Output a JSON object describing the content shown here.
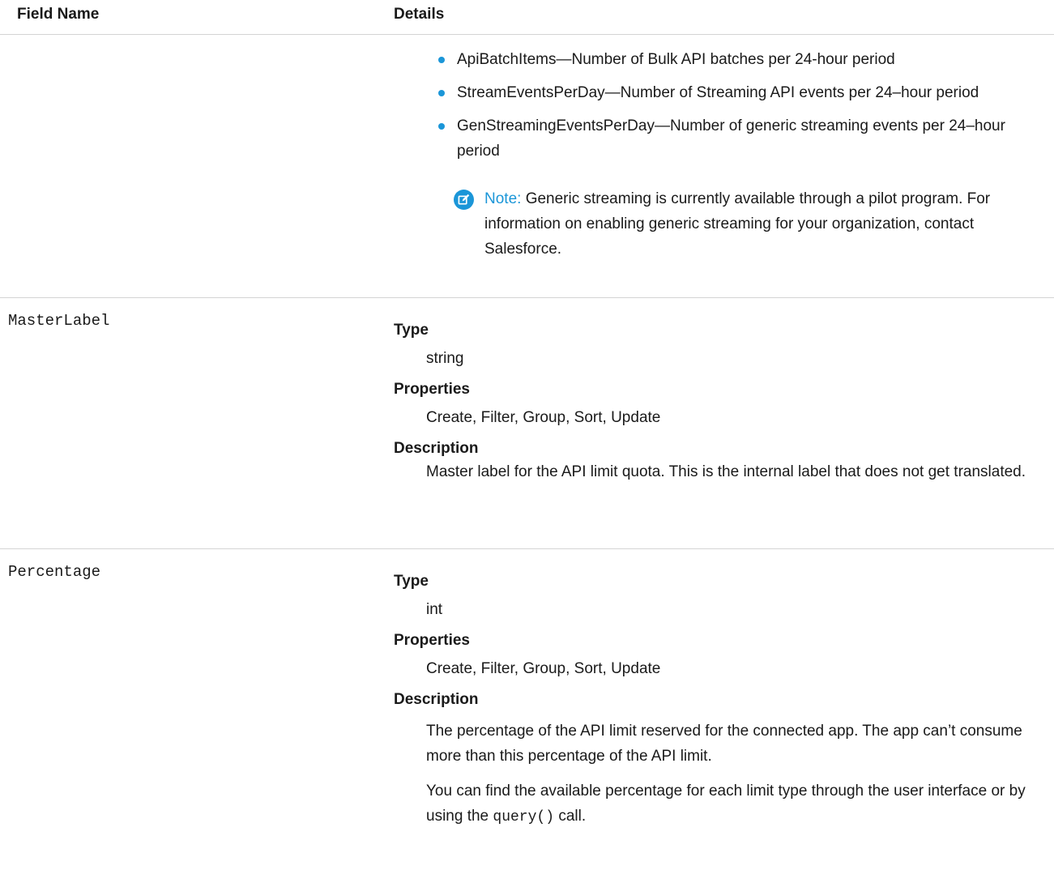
{
  "header": {
    "field_name": "Field Name",
    "details": "Details"
  },
  "continuation": {
    "bullets": [
      "ApiBatchItems—Number of Bulk API batches per 24-hour period",
      "StreamEventsPerDay—Number of Streaming API events per 24–hour period",
      "GenStreamingEventsPerDay—Number of generic streaming events per 24–hour period"
    ],
    "note": {
      "label": "Note:",
      "text": "Generic streaming is currently available through a pilot program. For information on enabling generic streaming for your organization, contact Salesforce."
    }
  },
  "rows": [
    {
      "name": "MasterLabel",
      "type_label": "Type",
      "type": "string",
      "properties_label": "Properties",
      "properties": "Create, Filter, Group, Sort, Update",
      "description_label": "Description",
      "description": "Master label for the API limit quota. This is the internal label that does not get translated."
    },
    {
      "name": "Percentage",
      "type_label": "Type",
      "type": "int",
      "properties_label": "Properties",
      "properties": "Create, Filter, Group, Sort, Update",
      "description_label": "Description",
      "description": "The percentage of the API limit reserved for the connected app. The app can’t consume more than this percentage of the API limit.",
      "description2_before": "You can find the available percentage for each limit type through the user interface or by using the",
      "description2_code": "query()",
      "description2_after": "call."
    }
  ],
  "colors": {
    "accent": "#1b96d8",
    "rule": "#d4d4d4",
    "text": "#1a1a1a"
  }
}
